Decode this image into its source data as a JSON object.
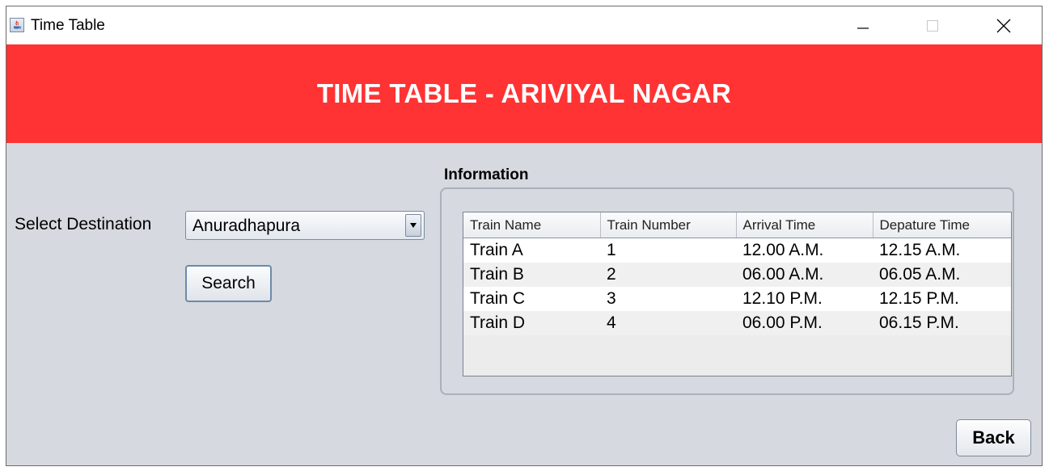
{
  "window": {
    "title": "Time Table",
    "icon": "java-app-icon",
    "controls": [
      "minimize-icon",
      "maximize-icon",
      "close-icon"
    ]
  },
  "header": {
    "title": "TIME TABLE - ARIVIYAL NAGAR",
    "background": "#ff3333"
  },
  "form": {
    "destination_label": "Select Destination",
    "destination_value": "Anuradhapura",
    "search_label": "Search"
  },
  "info": {
    "title": "Information",
    "columns": [
      "Train Name",
      "Train Number",
      "Arrival Time",
      "Depature Time"
    ],
    "rows": [
      [
        "Train A",
        "1",
        "12.00 A.M.",
        "12.15 A.M."
      ],
      [
        "Train B",
        "2",
        "06.00 A.M.",
        "06.05 A.M."
      ],
      [
        "Train C",
        "3",
        "12.10 P.M.",
        "12.15 P.M."
      ],
      [
        "Train D",
        "4",
        "06.00 P.M.",
        "06.15 P.M."
      ]
    ]
  },
  "footer": {
    "back_label": "Back"
  }
}
